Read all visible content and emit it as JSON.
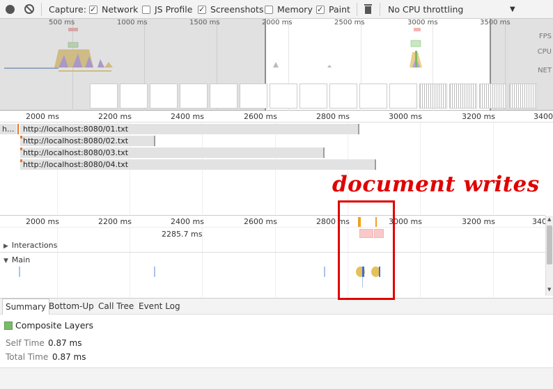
{
  "toolbar": {
    "capture_label": "Capture:",
    "network_label": "Network",
    "js_profile_label": "JS Profile",
    "screenshots_label": "Screenshots",
    "memory_label": "Memory",
    "paint_label": "Paint",
    "throttling_value": "No CPU throttling",
    "network_checked": true,
    "js_profile_checked": false,
    "screenshots_checked": true,
    "memory_checked": false,
    "paint_checked": true
  },
  "overview": {
    "ticks": [
      "500 ms",
      "1000 ms",
      "1500 ms",
      "2000 ms",
      "2500 ms",
      "3000 ms",
      "3500 ms"
    ],
    "fps_label": "FPS",
    "cpu_label": "CPU",
    "net_label": "NET"
  },
  "network": {
    "ruler": [
      "2000 ms",
      "2200 ms",
      "2400 ms",
      "2600 ms",
      "2800 ms",
      "3000 ms",
      "3200 ms",
      "3400"
    ],
    "truncated_prefix": "h...",
    "requests": [
      {
        "url": "http://localhost:8080/01.txt"
      },
      {
        "url": "http://localhost:8080/02.txt"
      },
      {
        "url": "http://localhost:8080/03.txt"
      },
      {
        "url": "http://localhost:8080/04.txt"
      }
    ]
  },
  "flame": {
    "ruler": [
      "2000 ms",
      "2200 ms",
      "2400 ms",
      "2600 ms",
      "2800 ms",
      "3000 ms",
      "3200 ms",
      "340"
    ],
    "marker_label": "2285.7 ms",
    "interactions_label": "Interactions",
    "main_label": "Main"
  },
  "tabs": [
    "Summary",
    "Bottom-Up",
    "Call Tree",
    "Event Log"
  ],
  "summary": {
    "title": "Composite Layers",
    "swatch_color": "#7cba6b",
    "self_time_label": "Self Time",
    "self_time_value": "0.87 ms",
    "total_time_label": "Total Time",
    "total_time_value": "0.87 ms"
  },
  "annotation": {
    "text": "document writes",
    "color": "#e00000"
  }
}
